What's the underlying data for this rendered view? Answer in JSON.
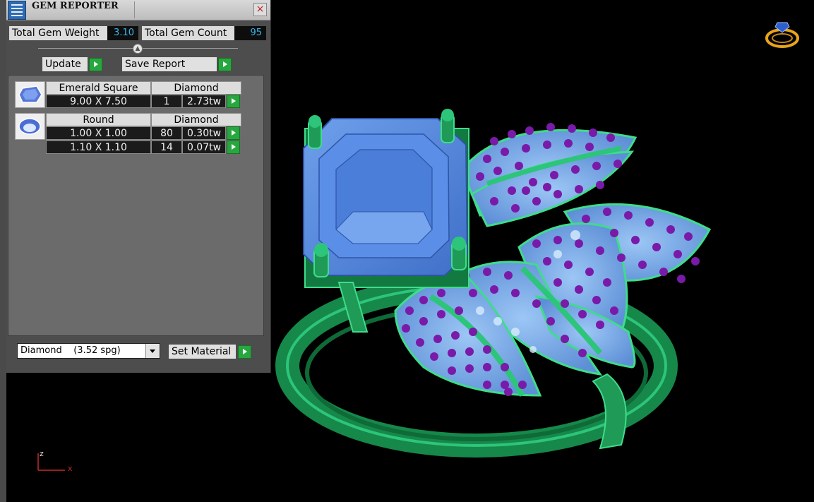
{
  "panel": {
    "title": "GEM REPORTER",
    "close_glyph": "×",
    "icons": {
      "app": "gem-report-icon",
      "close": "close-icon"
    },
    "total_gem_weight_label": "Total Gem Weight",
    "total_gem_weight_value": "3.10",
    "total_gem_count_label": "Total Gem Count",
    "total_gem_count_value": "95",
    "update_label": "Update",
    "save_report_label": "Save Report",
    "gems": [
      {
        "shape": "Emerald Square",
        "material": "Diamond",
        "icon": "emerald-square-gem-icon",
        "rows": [
          {
            "size": "9.00 X 7.50",
            "count": "1",
            "weight": "2.73tw"
          }
        ]
      },
      {
        "shape": "Round",
        "material": "Diamond",
        "icon": "round-gem-icon",
        "rows": [
          {
            "size": "1.00 X 1.00",
            "count": "80",
            "weight": "0.30tw"
          },
          {
            "size": "1.10 X 1.10",
            "count": "14",
            "weight": "0.07tw"
          }
        ]
      }
    ],
    "material_selected": "Diamond    (3.52 spg)",
    "set_material_label": "Set Material"
  },
  "viewport": {
    "axis_z": "z",
    "axis_x": "x",
    "view_icon": "ring-view-icon"
  },
  "colors": {
    "ring_green": "#1f9a57",
    "gem_blue": "#4f86e0",
    "pave_blue": "#8bb8f0",
    "pave_purple": "#7a1aa8",
    "value_cyan": "#39b8e8",
    "go_green": "#27a83e"
  }
}
